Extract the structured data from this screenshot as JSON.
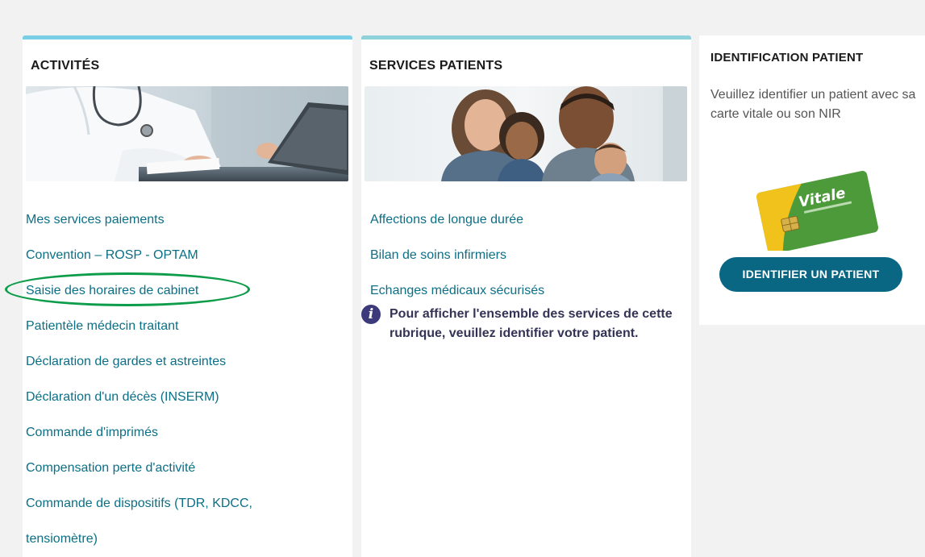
{
  "activites": {
    "title": "ACTIVITÉS",
    "photo": "doctor-laptop-photo",
    "links": [
      "Mes services paiements",
      "Convention – ROSP - OPTAM",
      "Saisie des horaires de cabinet",
      "Patientèle médecin traitant",
      "Déclaration de gardes et astreintes",
      "Déclaration d'un décès (INSERM)",
      "Commande d'imprimés",
      "Compensation perte d'activité",
      "Commande de dispositifs (TDR, KDCC,",
      "tensiomètre)"
    ],
    "highlighted_link": "Saisie des horaires de cabinet"
  },
  "services": {
    "title": "SERVICES PATIENTS",
    "photo": "family-photo",
    "links": [
      "Affections de longue durée",
      "Bilan de soins infirmiers",
      "Echanges médicaux sécurisés"
    ],
    "info": "Pour afficher l'ensemble des services de cette rubrique, veuillez identifier votre patient."
  },
  "identification": {
    "title": "IDENTIFICATION PATIENT",
    "text": "Veuillez identifier un patient avec sa carte vitale ou son NIR",
    "card_brand": "Vitale",
    "button": "IDENTIFIER UN PATIENT"
  },
  "colors": {
    "link": "#0b6f86",
    "button": "#0a6783",
    "highlight": "#0d9c4a",
    "accent_top": "#78cfe6"
  }
}
